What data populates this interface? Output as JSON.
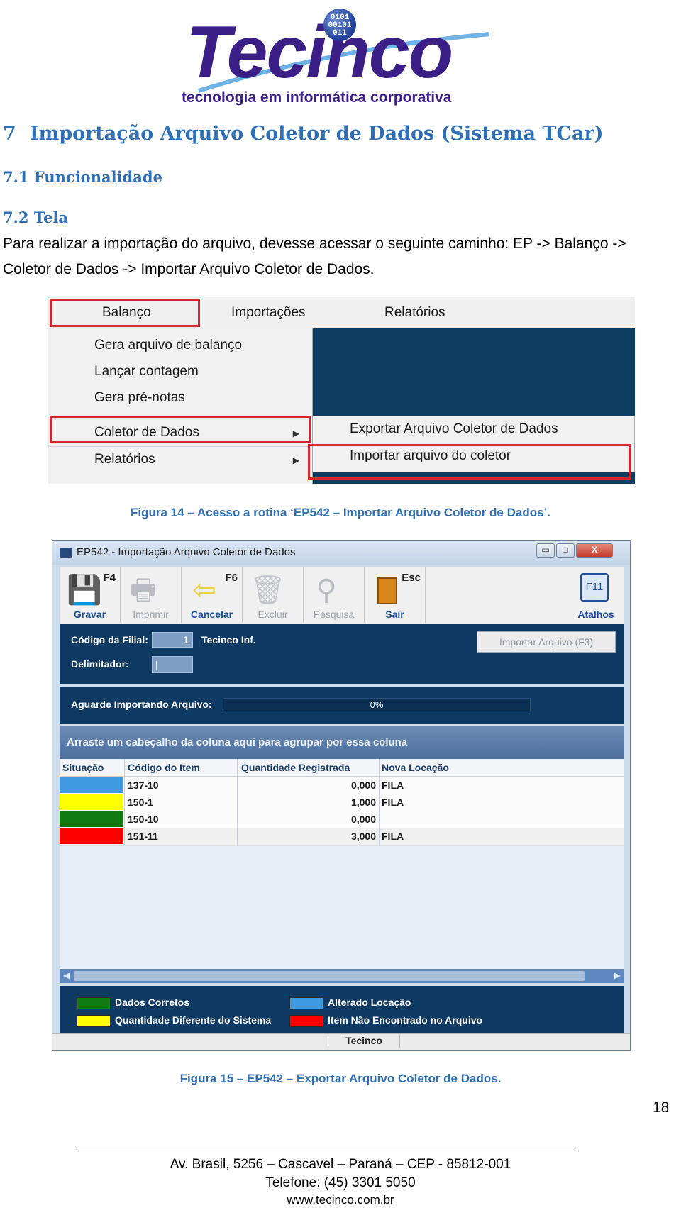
{
  "logo": {
    "word": "Tecinco",
    "tagline": "tecnologia em informática corporativa",
    "ball_text": "0101\n00101\n011"
  },
  "heading1": {
    "number": "7",
    "title": "Importação Arquivo Coletor de Dados (Sistema TCar)"
  },
  "heading2a": "7.1 Funcionalidade",
  "heading2b": "7.2 Tela",
  "paragraph": "Para realizar a importação do arquivo, devesse acessar o seguinte caminho: EP -> Balanço -> Coletor de Dados -> Importar Arquivo Coletor de Dados.",
  "screenshot1": {
    "menubar": [
      "Balanço",
      "Importações",
      "Relatórios"
    ],
    "menu_items": [
      "Gera arquivo de balanço",
      "Lançar contagem",
      "Gera pré-notas",
      "Coletor de Dados",
      "Relatórios"
    ],
    "submenu_items": [
      "Exportar Arquivo Coletor de Dados",
      "Importar arquivo do coletor"
    ],
    "highlight_color": "#d7232e"
  },
  "caption1": "Figura 14 – Acesso a rotina ‘EP542 – Importar Arquivo Coletor de Dados’.",
  "window": {
    "title": "EP542 - Importação Arquivo Coletor de Dados",
    "toolbar": [
      {
        "key": "F4",
        "label": "Gravar",
        "icon": "floppy-disk-icon"
      },
      {
        "key": "",
        "label": "Imprimir",
        "icon": "printer-icon"
      },
      {
        "key": "F6",
        "label": "Cancelar",
        "icon": "arrow-left-icon"
      },
      {
        "key": "",
        "label": "Excluir",
        "icon": "trash-icon"
      },
      {
        "key": "",
        "label": "Pesquisa",
        "icon": "magnifier-icon"
      },
      {
        "key": "Esc",
        "label": "Sair",
        "icon": "door-icon"
      }
    ],
    "atalhos_key": "F11",
    "atalhos_label": "Atalhos",
    "filial_label": "Código da Filial:",
    "filial_value": "1",
    "filial_name": "Tecinco Inf.",
    "delimitador_label": "Delimitador:",
    "delimitador_value": "|",
    "import_button": "Importar Arquivo (F3)",
    "progress_label": "Aguarde Importando Arquivo:",
    "progress_text": "0%",
    "progress_value": 0,
    "group_hint": "Arraste um cabeçalho da coluna aqui para agrupar por essa coluna",
    "columns": [
      "Situação",
      "Código do Item",
      "Quantidade Registrada",
      "Nova Locação"
    ],
    "rows": [
      {
        "color": "#3f9ae0",
        "code": "137-10",
        "qty": "0,000",
        "loc": "FILA"
      },
      {
        "color": "#ffff00",
        "code": "150-1",
        "qty": "1,000",
        "loc": "FILA"
      },
      {
        "color": "#0f7a0f",
        "code": "150-10",
        "qty": "0,000",
        "loc": ""
      },
      {
        "color": "#ff0000",
        "code": "151-11",
        "qty": "3,000",
        "loc": "FILA"
      }
    ],
    "legend": [
      {
        "color": "#0f7a0f",
        "label": "Dados Corretos"
      },
      {
        "color": "#3f9ae0",
        "label": "Alterado Locação"
      },
      {
        "color": "#ffff00",
        "label": "Quantidade Diferente do Sistema"
      },
      {
        "color": "#ff0000",
        "label": "Item Não Encontrado no Arquivo"
      }
    ],
    "status": "Tecinco"
  },
  "caption2": "Figura 15 – EP542 – Exportar Arquivo Coletor de Dados.",
  "page_number": "18",
  "footer": {
    "address": "Av. Brasil, 5256 – Cascavel – Paraná – CEP - 85812-001",
    "phone": "Telefone: (45) 3301 5050",
    "site": "www.tecinco.com.br"
  }
}
